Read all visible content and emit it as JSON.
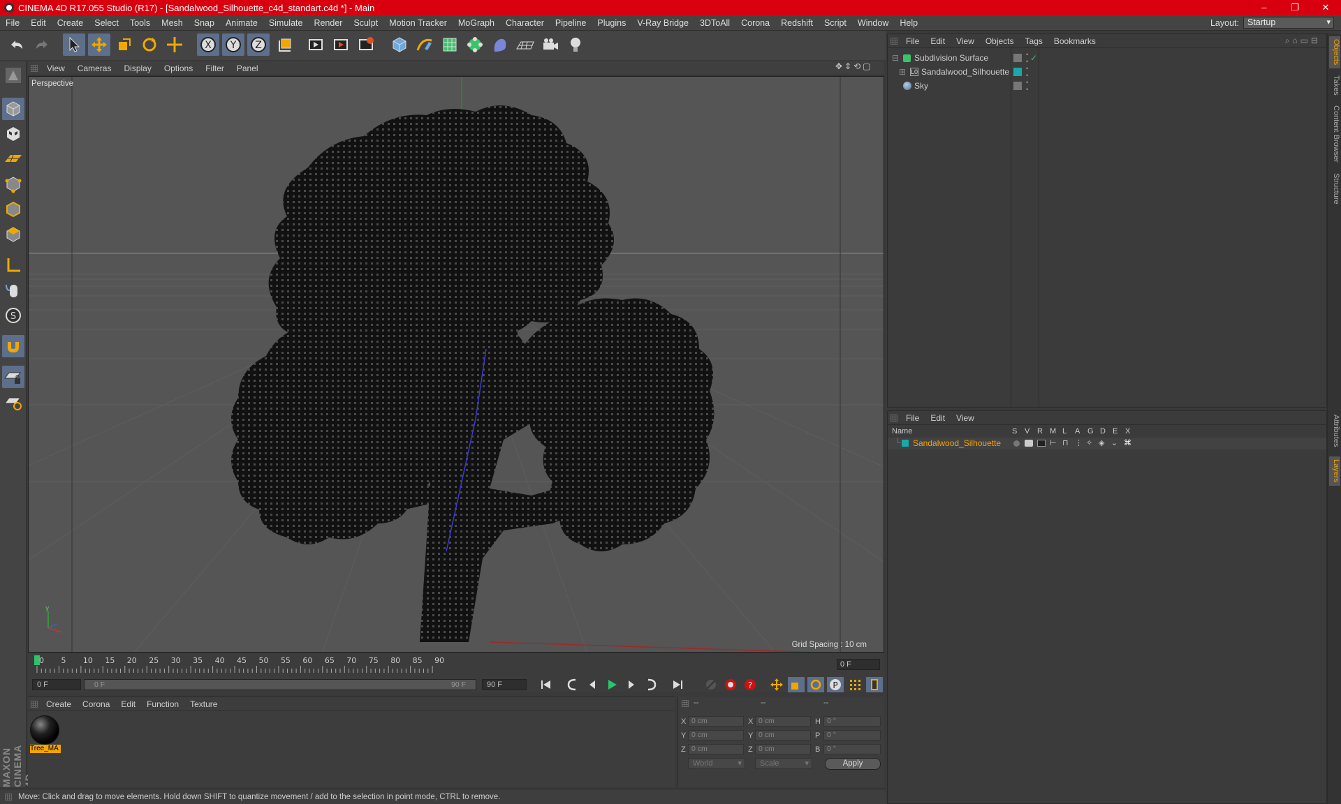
{
  "window": {
    "title": "CINEMA 4D R17.055 Studio (R17) - [Sandalwood_Silhouette_c4d_standart.c4d *] - Main",
    "minimize": "–",
    "maximize": "❐",
    "close": "✕"
  },
  "menubar": [
    "File",
    "Edit",
    "Create",
    "Select",
    "Tools",
    "Mesh",
    "Snap",
    "Animate",
    "Simulate",
    "Render",
    "Sculpt",
    "Motion Tracker",
    "MoGraph",
    "Character",
    "Pipeline",
    "Plugins",
    "V-Ray Bridge",
    "3DToAll",
    "Corona",
    "Redshift",
    "Script",
    "Window",
    "Help"
  ],
  "layout": {
    "label": "Layout:",
    "value": "Startup"
  },
  "viewport": {
    "menu": [
      "View",
      "Cameras",
      "Display",
      "Options",
      "Filter",
      "Panel"
    ],
    "label": "Perspective",
    "grid_spacing": "Grid Spacing : 10 cm"
  },
  "timeline": {
    "ticks": [
      "0",
      "5",
      "10",
      "15",
      "20",
      "25",
      "30",
      "35",
      "40",
      "45",
      "50",
      "55",
      "60",
      "65",
      "70",
      "75",
      "80",
      "85",
      "90"
    ],
    "end_frame": "0 F"
  },
  "transport": {
    "start": "0 F",
    "slider_start": "0 F",
    "slider_end": "90 F",
    "end": "90 F"
  },
  "materials": {
    "menu": [
      "Create",
      "Corona",
      "Edit",
      "Function",
      "Texture"
    ],
    "items": [
      {
        "name": "Tree_MA"
      }
    ]
  },
  "coords": {
    "header": [
      "--",
      "--",
      "--"
    ],
    "rows": [
      {
        "axis": "X",
        "pos": "0 cm",
        "axis2": "X",
        "size": "0 cm",
        "rot_label": "H",
        "rot": "0 °"
      },
      {
        "axis": "Y",
        "pos": "0 cm",
        "axis2": "Y",
        "size": "0 cm",
        "rot_label": "P",
        "rot": "0 °"
      },
      {
        "axis": "Z",
        "pos": "0 cm",
        "axis2": "Z",
        "size": "0 cm",
        "rot_label": "B",
        "rot": "0 °"
      }
    ],
    "mode1": "World",
    "mode2": "Scale",
    "apply": "Apply"
  },
  "objects": {
    "menu": [
      "File",
      "Edit",
      "View",
      "Objects",
      "Tags",
      "Bookmarks"
    ],
    "items": [
      {
        "name": "Subdivision Surface",
        "icon": "subdivision-icon"
      },
      {
        "name": "Sandalwood_Silhouette",
        "icon": "polygon-object-icon"
      },
      {
        "name": "Sky",
        "icon": "sky-icon"
      }
    ]
  },
  "layers": {
    "menu": [
      "File",
      "Edit",
      "View"
    ],
    "headers": [
      "Name",
      "S",
      "V",
      "R",
      "M",
      "L",
      "A",
      "G",
      "D",
      "E",
      "X"
    ],
    "items": [
      {
        "name": "Sandalwood_Silhouette",
        "color": "#1aa8a8"
      }
    ]
  },
  "right_tabs": [
    "Objects",
    "Takes",
    "Content Browser",
    "Structure",
    "Attributes",
    "Layers"
  ],
  "status": "Move: Click and drag to move elements. Hold down SHIFT to quantize movement / add to the selection in point mode, CTRL to remove.",
  "brand": "MAXON CINEMA 4D",
  "colors": {
    "title_bar": "#d8000f",
    "accent": "#f5a400",
    "highlight_blue": "#5d6f8a"
  }
}
